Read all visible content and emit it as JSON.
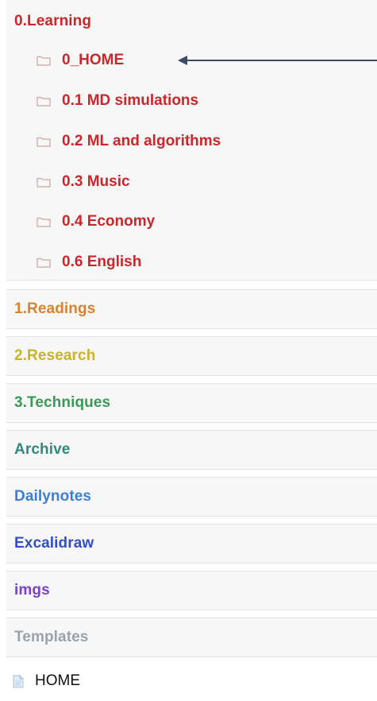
{
  "explorer": {
    "top_folder": {
      "label": "0.Learning",
      "color": "#c9272b",
      "children": [
        {
          "label": "0_HOME",
          "icon": "folder-icon"
        },
        {
          "label": "0.1 MD simulations",
          "icon": "folder-icon"
        },
        {
          "label": "0.2 ML and algorithms",
          "icon": "folder-icon"
        },
        {
          "label": "0.3 Music",
          "icon": "folder-icon"
        },
        {
          "label": "0.4 Economy",
          "icon": "folder-icon"
        },
        {
          "label": "0.6 English",
          "icon": "folder-icon"
        }
      ]
    },
    "folders": [
      {
        "label": "1.Readings",
        "color": "#d9822b"
      },
      {
        "label": "2.Research",
        "color": "#c9b22b"
      },
      {
        "label": "3.Techniques",
        "color": "#3a9a55"
      },
      {
        "label": "Archive",
        "color": "#2f8a7e"
      },
      {
        "label": "Dailynotes",
        "color": "#3b7fd4"
      },
      {
        "label": "Excalidraw",
        "color": "#2f4fc8"
      },
      {
        "label": "imgs",
        "color": "#7b3fd0"
      },
      {
        "label": "Templates",
        "color": "#9aa3ad"
      }
    ],
    "file": {
      "label": "HOME",
      "icon": "file-icon"
    }
  }
}
